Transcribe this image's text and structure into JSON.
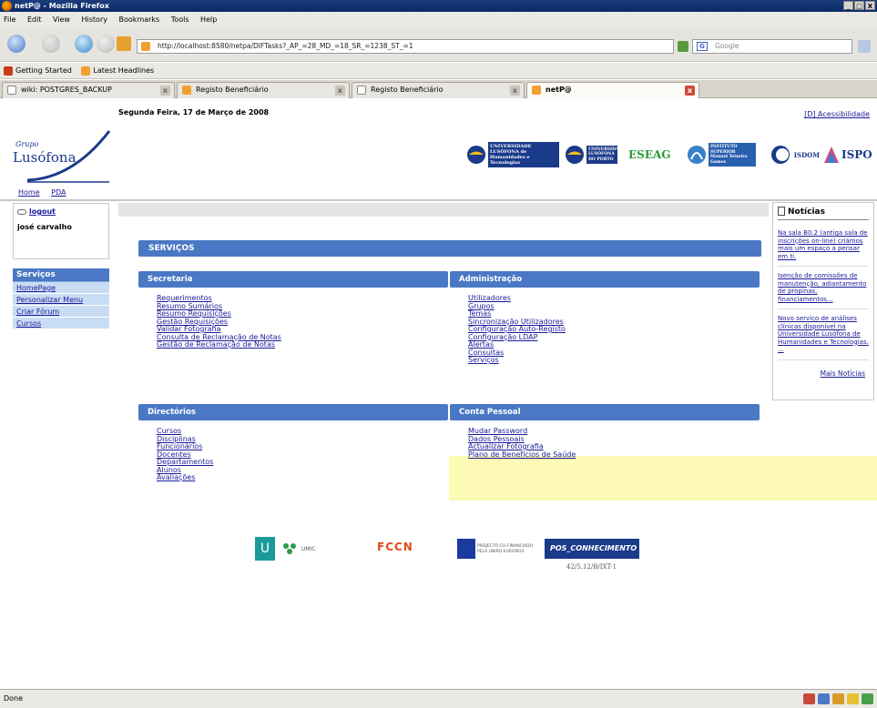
{
  "window": {
    "title": "netP@ - Mozilla Firefox",
    "buttons": [
      "_",
      "□",
      "X"
    ]
  },
  "menubar": [
    "File",
    "Edit",
    "View",
    "History",
    "Bookmarks",
    "Tools",
    "Help"
  ],
  "navbar": {
    "url": "http://localhost:8580/netpa/DIFTasks?_AP_=28_MD_=18_SR_=1238_ST_=1",
    "search_placeholder": "Google"
  },
  "bookmarks": [
    "Getting Started",
    "Latest Headlines"
  ],
  "tabs": [
    {
      "label": "wiki: POSTGRES_BACKUP",
      "active": false
    },
    {
      "label": "Registo Beneficiário",
      "active": false
    },
    {
      "label": "Registo Beneficiário",
      "active": false
    },
    {
      "label": "netP@",
      "active": true
    }
  ],
  "page": {
    "date": "Segunda Feira, 17 de Março de 2008",
    "accessibility": "[D] Acessibilidade",
    "logo": {
      "grupo": "Grupo",
      "name": "Lusófona"
    },
    "topnav": [
      "Home",
      "PDA"
    ],
    "institutions": [
      {
        "text": "UNIVERSIDADE LUSÓFONA de Humanidades e Tecnologias",
        "color": "#1a3a8a"
      },
      {
        "text": "UNIVERSIDADE LUSÓFONA DO PORTO",
        "color": "#1a3a8a"
      },
      {
        "text": "ESEAG",
        "color": "#2a9a3a"
      },
      {
        "text": "INSTITUTO SUPERIOR Manuel Teixeira Gomes",
        "color": "#2a60b0"
      },
      {
        "text": "ISDOM",
        "color": "#1a3a8a"
      },
      {
        "text": "ISPO",
        "color": "#1a3a8a"
      }
    ],
    "user": {
      "logout": "logout",
      "name": "josé carvalho"
    },
    "sidebar": {
      "title": "Serviços",
      "items": [
        "HomePage",
        "Personalizar Menu",
        "Criar Fórum",
        "Cursos"
      ]
    },
    "services_title": "SERVIÇOS",
    "sections": {
      "secretaria": {
        "title": "Secretaria",
        "links": [
          "Requerimentos",
          "Resumo Sumários",
          "Resumo Requisições",
          "Gestão Requisições",
          "Validar Fotografia",
          "Consulta de Reclamação de Notas",
          "Gestão de Reclamação de Notas"
        ]
      },
      "administracao": {
        "title": "Administração",
        "links": [
          "Utilizadores",
          "Grupos",
          "Temas",
          "Sincronização Utilizadores",
          "Configuração Auto-Registo",
          "Configuração LDAP",
          "Alertas",
          "Consultas",
          "Serviços"
        ]
      },
      "directorios": {
        "title": "Directórios",
        "links": [
          "Cursos",
          "Disciplinas",
          "Funcionários",
          "Docentes",
          "Departamentos",
          "Alunos",
          "Avaliações"
        ]
      },
      "conta": {
        "title": "Conta Pessoal",
        "links": [
          "Mudar Password",
          "Dados Pessoais",
          "Actualizar Fotografia",
          "Plano de Benefícios de Saúde"
        ]
      }
    },
    "footer": {
      "logos": [
        "UMIC",
        "FCCN",
        "PROJECTO CO-FINANCIADO PELA UNIÃO EUROPEIA",
        "POS_CONHECIMENTO"
      ],
      "code": "42/5.12/B/IXT-1"
    },
    "news": {
      "title": "Notícias",
      "items": [
        "Na sala B0.2 (antiga sala de inscrições on-line) criámos mais um espaço a pensar em ti.",
        "Isenção de comissões de manutenção, adiantamento de propinas, financiamentos...",
        "Novo serviço de análises clínicas disponível na Universidade Lusófona de Humanidades e Tecnologias. ..."
      ],
      "more": "Mais Notícias"
    }
  },
  "statusbar": {
    "text": "Done"
  }
}
